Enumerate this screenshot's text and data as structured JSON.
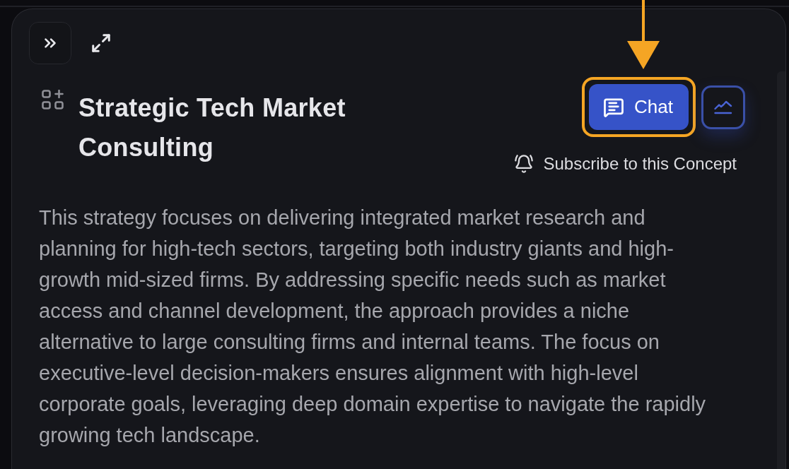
{
  "concept": {
    "title": "Strategic Tech Market Consulting",
    "chat_button": "Chat",
    "subscribe": "Subscribe to this Concept",
    "description": "This strategy focuses on delivering integrated market research and planning for high-tech sectors, targeting both industry giants and high-growth mid-sized firms. By addressing specific needs such as market access and channel development, the approach provides a niche alternative to large consulting firms and internal teams. The focus on executive-level decision-makers ensures alignment with high-level corporate goals, leveraging deep domain expertise to navigate the rapidly growing tech landscape."
  }
}
